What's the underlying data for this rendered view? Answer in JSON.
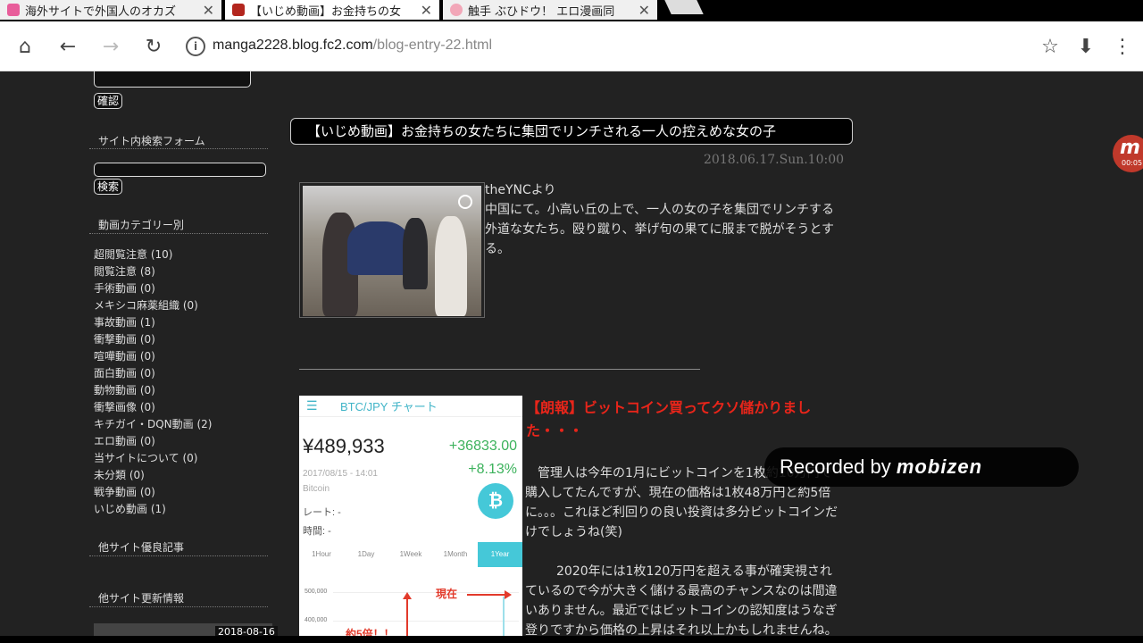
{
  "browser": {
    "tabs": [
      {
        "title": "海外サイトで外国人のオカズ",
        "favicon_color": "#e85d9a",
        "active": false
      },
      {
        "title": "【いじめ動画】お金持ちの女",
        "favicon_color": "#b3261e",
        "active": true
      },
      {
        "title": "触手 ぶひドウ！ エロ漫画同",
        "favicon_color": "#f2a7b8",
        "active": false
      }
    ],
    "close_glyph": "✕",
    "url_domain": "manga2228.blog.fc2.com",
    "url_path": "/blog-entry-22.html",
    "icons": {
      "home": "⌂",
      "back": "←",
      "forward": "→",
      "reload": "↻",
      "info": "i",
      "star": "☆",
      "download": "⬇",
      "menu": "⋮"
    }
  },
  "sidebar": {
    "confirm_button": "確認",
    "site_search_heading": "サイト内検索フォーム",
    "search_button": "検索",
    "category_heading": "動画カテゴリー別",
    "categories": [
      "超閲覧注意 (10)",
      "閲覧注意 (8)",
      "手術動画 (0)",
      "メキシコ麻薬組織 (0)",
      "事故動画 (1)",
      "衝撃動画 (0)",
      "喧嘩動画 (0)",
      "面白動画 (0)",
      "動物動画 (0)",
      "衝撃画像 (0)",
      "キチガイ・DQN動画 (2)",
      "エロ動画 (0)",
      "当サイトについて (0)",
      "未分類 (0)",
      "戦争動画 (0)",
      "いじめ動画 (1)"
    ],
    "other_articles_heading": "他サイト優良記事",
    "other_updates_heading": "他サイト更新情報",
    "latest_date": "2018-08-16"
  },
  "article": {
    "title": "【いじめ動画】お金持ちの女たちに集団でリンチされる一人の控えめな女の子",
    "date": "2018.06.17.Sun.10:00",
    "source": "theYNCより",
    "body": "中国にて。小高い丘の上で、一人の女の子を集団でリンチする外道な女たち。殴り蹴り、挙げ句の果てに服まで脱がそうとする。"
  },
  "ad": {
    "chart_header": "BTC/JPY チャート",
    "menu_glyph": "☰",
    "price": "¥489,933",
    "change": "+36833.00",
    "change_pct": "+8.13%",
    "timestamp": "2017/08/15 - 14:01",
    "coin_name": "Bitcoin",
    "coin_glyph": "₿",
    "rate_label": "レート: -",
    "time_label": "時間: -",
    "periods": [
      "1Hour",
      "1Day",
      "1Week",
      "1Month",
      "1Year"
    ],
    "selected_period": "1Year",
    "axis_top": "500,000",
    "axis_mid": "400,000",
    "now_label": "現在",
    "growth_label": "約5倍！！",
    "headline": "【朗報】ビットコイン買ってクソ儲かりました・・・",
    "paragraph_1": "管理人は今年の1月にビットコインを1枚約10万円で購入してたんですが、現在の価格は1枚48万円と約5倍に。。。これほど利回りの良い投資は多分ビットコインだけでしょうね(笑)",
    "paragraph_2": "2020年には1枚120万円を超える事が確実視されているので今が大きく儲ける最高のチャンスなのは間違いありません。最近ではビットコインの認知度はうなぎ登りですから価格の上昇はそれ以上かもしれませんね。"
  },
  "overlay": {
    "recorded_prefix": "Recorded by",
    "recorded_brand": "mobizen",
    "bubble_letter": "m",
    "bubble_time": "00:05"
  }
}
